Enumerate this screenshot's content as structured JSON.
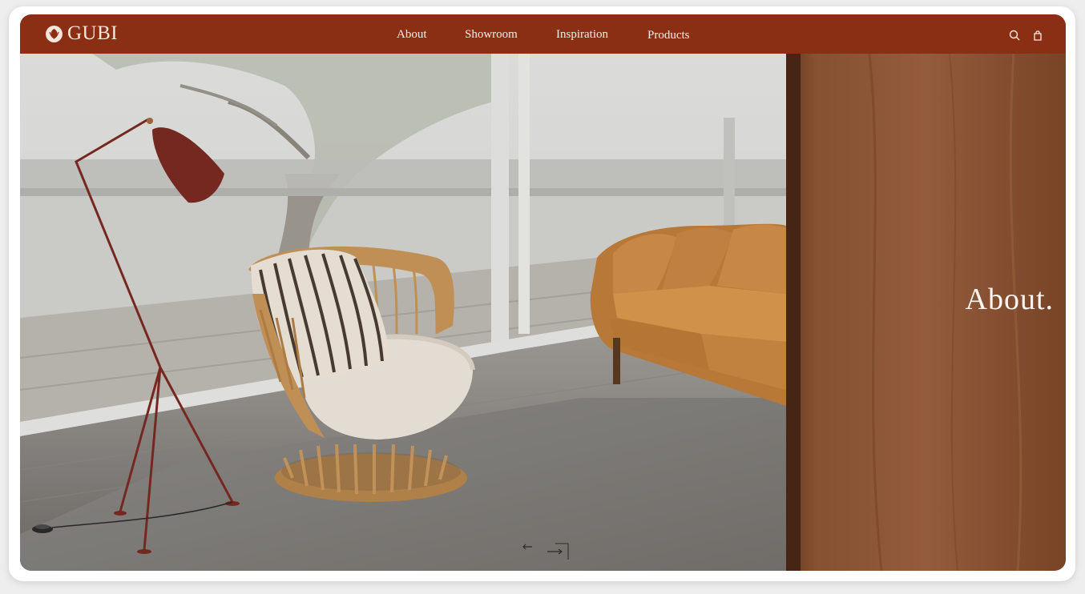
{
  "brand": {
    "name": "GUBI"
  },
  "colors": {
    "header_bg": "#8a2f14",
    "header_text": "#f5ece5",
    "hero_title": "#fbf5ef",
    "wood_panel": "#8a4e2c",
    "sofa": "#c9853f",
    "lamp": "#7a2a22"
  },
  "nav": {
    "items": [
      {
        "label": "About"
      },
      {
        "label": "Showroom"
      },
      {
        "label": "Inspiration"
      },
      {
        "label": "Products"
      }
    ]
  },
  "icons": {
    "search": "search-icon",
    "bag": "bag-icon",
    "prev": "arrow-left-icon",
    "next": "arrow-right-icon"
  },
  "hero": {
    "title": "About."
  }
}
